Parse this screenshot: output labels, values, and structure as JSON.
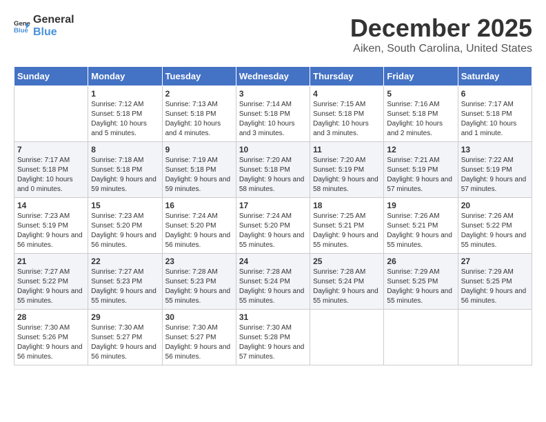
{
  "logo": {
    "general": "General",
    "blue": "Blue"
  },
  "title": {
    "month": "December 2025",
    "location": "Aiken, South Carolina, United States"
  },
  "headers": [
    "Sunday",
    "Monday",
    "Tuesday",
    "Wednesday",
    "Thursday",
    "Friday",
    "Saturday"
  ],
  "weeks": [
    [
      {
        "day": "",
        "sunrise": "",
        "sunset": "",
        "daylight": ""
      },
      {
        "day": "1",
        "sunrise": "Sunrise: 7:12 AM",
        "sunset": "Sunset: 5:18 PM",
        "daylight": "Daylight: 10 hours and 5 minutes."
      },
      {
        "day": "2",
        "sunrise": "Sunrise: 7:13 AM",
        "sunset": "Sunset: 5:18 PM",
        "daylight": "Daylight: 10 hours and 4 minutes."
      },
      {
        "day": "3",
        "sunrise": "Sunrise: 7:14 AM",
        "sunset": "Sunset: 5:18 PM",
        "daylight": "Daylight: 10 hours and 3 minutes."
      },
      {
        "day": "4",
        "sunrise": "Sunrise: 7:15 AM",
        "sunset": "Sunset: 5:18 PM",
        "daylight": "Daylight: 10 hours and 3 minutes."
      },
      {
        "day": "5",
        "sunrise": "Sunrise: 7:16 AM",
        "sunset": "Sunset: 5:18 PM",
        "daylight": "Daylight: 10 hours and 2 minutes."
      },
      {
        "day": "6",
        "sunrise": "Sunrise: 7:17 AM",
        "sunset": "Sunset: 5:18 PM",
        "daylight": "Daylight: 10 hours and 1 minute."
      }
    ],
    [
      {
        "day": "7",
        "sunrise": "Sunrise: 7:17 AM",
        "sunset": "Sunset: 5:18 PM",
        "daylight": "Daylight: 10 hours and 0 minutes."
      },
      {
        "day": "8",
        "sunrise": "Sunrise: 7:18 AM",
        "sunset": "Sunset: 5:18 PM",
        "daylight": "Daylight: 9 hours and 59 minutes."
      },
      {
        "day": "9",
        "sunrise": "Sunrise: 7:19 AM",
        "sunset": "Sunset: 5:18 PM",
        "daylight": "Daylight: 9 hours and 59 minutes."
      },
      {
        "day": "10",
        "sunrise": "Sunrise: 7:20 AM",
        "sunset": "Sunset: 5:18 PM",
        "daylight": "Daylight: 9 hours and 58 minutes."
      },
      {
        "day": "11",
        "sunrise": "Sunrise: 7:20 AM",
        "sunset": "Sunset: 5:19 PM",
        "daylight": "Daylight: 9 hours and 58 minutes."
      },
      {
        "day": "12",
        "sunrise": "Sunrise: 7:21 AM",
        "sunset": "Sunset: 5:19 PM",
        "daylight": "Daylight: 9 hours and 57 minutes."
      },
      {
        "day": "13",
        "sunrise": "Sunrise: 7:22 AM",
        "sunset": "Sunset: 5:19 PM",
        "daylight": "Daylight: 9 hours and 57 minutes."
      }
    ],
    [
      {
        "day": "14",
        "sunrise": "Sunrise: 7:23 AM",
        "sunset": "Sunset: 5:19 PM",
        "daylight": "Daylight: 9 hours and 56 minutes."
      },
      {
        "day": "15",
        "sunrise": "Sunrise: 7:23 AM",
        "sunset": "Sunset: 5:20 PM",
        "daylight": "Daylight: 9 hours and 56 minutes."
      },
      {
        "day": "16",
        "sunrise": "Sunrise: 7:24 AM",
        "sunset": "Sunset: 5:20 PM",
        "daylight": "Daylight: 9 hours and 56 minutes."
      },
      {
        "day": "17",
        "sunrise": "Sunrise: 7:24 AM",
        "sunset": "Sunset: 5:20 PM",
        "daylight": "Daylight: 9 hours and 55 minutes."
      },
      {
        "day": "18",
        "sunrise": "Sunrise: 7:25 AM",
        "sunset": "Sunset: 5:21 PM",
        "daylight": "Daylight: 9 hours and 55 minutes."
      },
      {
        "day": "19",
        "sunrise": "Sunrise: 7:26 AM",
        "sunset": "Sunset: 5:21 PM",
        "daylight": "Daylight: 9 hours and 55 minutes."
      },
      {
        "day": "20",
        "sunrise": "Sunrise: 7:26 AM",
        "sunset": "Sunset: 5:22 PM",
        "daylight": "Daylight: 9 hours and 55 minutes."
      }
    ],
    [
      {
        "day": "21",
        "sunrise": "Sunrise: 7:27 AM",
        "sunset": "Sunset: 5:22 PM",
        "daylight": "Daylight: 9 hours and 55 minutes."
      },
      {
        "day": "22",
        "sunrise": "Sunrise: 7:27 AM",
        "sunset": "Sunset: 5:23 PM",
        "daylight": "Daylight: 9 hours and 55 minutes."
      },
      {
        "day": "23",
        "sunrise": "Sunrise: 7:28 AM",
        "sunset": "Sunset: 5:23 PM",
        "daylight": "Daylight: 9 hours and 55 minutes."
      },
      {
        "day": "24",
        "sunrise": "Sunrise: 7:28 AM",
        "sunset": "Sunset: 5:24 PM",
        "daylight": "Daylight: 9 hours and 55 minutes."
      },
      {
        "day": "25",
        "sunrise": "Sunrise: 7:28 AM",
        "sunset": "Sunset: 5:24 PM",
        "daylight": "Daylight: 9 hours and 55 minutes."
      },
      {
        "day": "26",
        "sunrise": "Sunrise: 7:29 AM",
        "sunset": "Sunset: 5:25 PM",
        "daylight": "Daylight: 9 hours and 55 minutes."
      },
      {
        "day": "27",
        "sunrise": "Sunrise: 7:29 AM",
        "sunset": "Sunset: 5:25 PM",
        "daylight": "Daylight: 9 hours and 56 minutes."
      }
    ],
    [
      {
        "day": "28",
        "sunrise": "Sunrise: 7:30 AM",
        "sunset": "Sunset: 5:26 PM",
        "daylight": "Daylight: 9 hours and 56 minutes."
      },
      {
        "day": "29",
        "sunrise": "Sunrise: 7:30 AM",
        "sunset": "Sunset: 5:27 PM",
        "daylight": "Daylight: 9 hours and 56 minutes."
      },
      {
        "day": "30",
        "sunrise": "Sunrise: 7:30 AM",
        "sunset": "Sunset: 5:27 PM",
        "daylight": "Daylight: 9 hours and 56 minutes."
      },
      {
        "day": "31",
        "sunrise": "Sunrise: 7:30 AM",
        "sunset": "Sunset: 5:28 PM",
        "daylight": "Daylight: 9 hours and 57 minutes."
      },
      {
        "day": "",
        "sunrise": "",
        "sunset": "",
        "daylight": ""
      },
      {
        "day": "",
        "sunrise": "",
        "sunset": "",
        "daylight": ""
      },
      {
        "day": "",
        "sunrise": "",
        "sunset": "",
        "daylight": ""
      }
    ]
  ]
}
